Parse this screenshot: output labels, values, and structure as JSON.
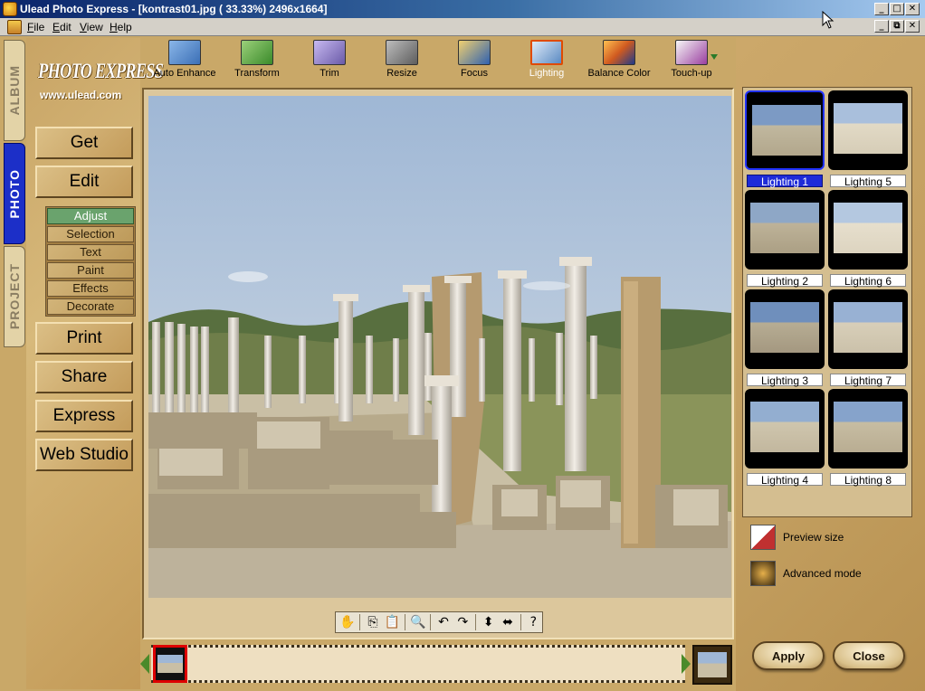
{
  "window": {
    "title": "Ulead Photo Express - [kontrast01.jpg ( 33.33%) 2496x1664]",
    "controls": {
      "minimize": "_",
      "maximize": "□",
      "close": "✕",
      "restore": "⧉"
    }
  },
  "menu": [
    "File",
    "Edit",
    "View",
    "Help"
  ],
  "side_tabs": {
    "album": "ALBUM",
    "photo": "PHOTO",
    "project": "PROJECT"
  },
  "logo": {
    "main": "PHOTO EXPRESS",
    "url": "www.ulead.com"
  },
  "nav": {
    "get": "Get",
    "edit": "Edit",
    "print": "Print",
    "share": "Share",
    "express": "Express",
    "web_studio": "Web Studio"
  },
  "edit_sub": [
    "Adjust",
    "Selection",
    "Text",
    "Paint",
    "Effects",
    "Decorate"
  ],
  "tools": [
    {
      "label": "Auto Enhance",
      "icon": "auto-enhance-icon",
      "color": "#3b6fb6"
    },
    {
      "label": "Transform",
      "icon": "transform-icon",
      "color": "#3a8a2a"
    },
    {
      "label": "Trim",
      "icon": "trim-icon",
      "color": "#6a5aa8"
    },
    {
      "label": "Resize",
      "icon": "resize-icon",
      "color": "#5d5d5d"
    },
    {
      "label": "Focus",
      "icon": "focus-icon",
      "color": "#2f61b0"
    },
    {
      "label": "Lighting",
      "icon": "lighting-icon",
      "color": "#5a8ac2",
      "active": true
    },
    {
      "label": "Balance Color",
      "icon": "balance-color-icon",
      "color": "#d05a20"
    },
    {
      "label": "Touch-up",
      "icon": "touch-up-icon",
      "color": "#9a3fa0"
    }
  ],
  "view_tools": [
    "✋",
    "⎘",
    "📋",
    "🔍",
    "↶",
    "↷",
    "⬍",
    "⬌",
    "?"
  ],
  "presets": [
    {
      "label": "Lighting 1",
      "selected": true
    },
    {
      "label": "Lighting 5"
    },
    {
      "label": "Lighting 2"
    },
    {
      "label": "Lighting 6"
    },
    {
      "label": "Lighting 3"
    },
    {
      "label": "Lighting 7"
    },
    {
      "label": "Lighting 4"
    },
    {
      "label": "Lighting 8"
    }
  ],
  "options": {
    "preview_size": "Preview size",
    "advanced_mode": "Advanced mode"
  },
  "buttons": {
    "apply": "Apply",
    "close": "Close"
  },
  "colors": {
    "accent": "#1c2fc8",
    "panel": "#c9a868",
    "titlebar": "#0a246a"
  }
}
